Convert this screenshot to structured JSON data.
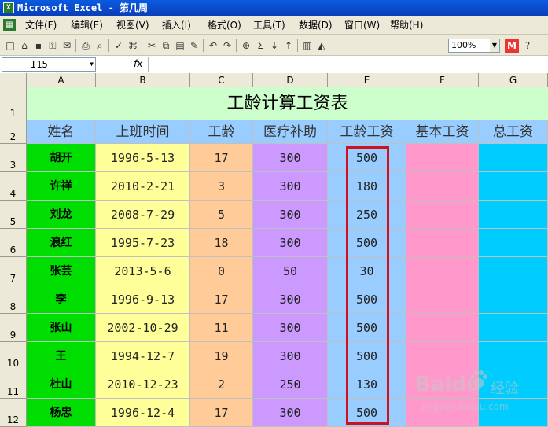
{
  "window": {
    "title": "Microsoft Excel - 第几周",
    "app_icon_name": "excel-icon"
  },
  "menu": {
    "items": [
      "文件(F)",
      "编辑(E)",
      "视图(V)",
      "插入(I)",
      "格式(O)",
      "工具(T)",
      "数据(D)",
      "窗口(W)",
      "帮助(H)"
    ]
  },
  "toolbar": {
    "zoom": "100%"
  },
  "formula_bar": {
    "name_box": "I15",
    "fx_label": "fx",
    "content": ""
  },
  "columns": [
    "A",
    "B",
    "C",
    "D",
    "E",
    "F",
    "G"
  ],
  "rows": [
    "1",
    "2",
    "3",
    "4",
    "5",
    "6",
    "7",
    "8",
    "9",
    "10",
    "11",
    "12"
  ],
  "sheet": {
    "title": "工龄计算工资表",
    "headers": [
      "姓名",
      "上班时间",
      "工龄",
      "医疗补助",
      "工龄工资",
      "基本工资",
      "总工资"
    ],
    "records": [
      {
        "name": "胡开",
        "start": "1996-5-13",
        "years": "17",
        "medical": "300",
        "seniority_pay": "500",
        "base": "",
        "total": ""
      },
      {
        "name": "许祥",
        "start": "2010-2-21",
        "years": "3",
        "medical": "300",
        "seniority_pay": "180",
        "base": "",
        "total": ""
      },
      {
        "name": "刘龙",
        "start": "2008-7-29",
        "years": "5",
        "medical": "300",
        "seniority_pay": "250",
        "base": "",
        "total": ""
      },
      {
        "name": "浪红",
        "start": "1995-7-23",
        "years": "18",
        "medical": "300",
        "seniority_pay": "500",
        "base": "",
        "total": ""
      },
      {
        "name": "张芸",
        "start": "2013-5-6",
        "years": "0",
        "medical": "50",
        "seniority_pay": "30",
        "base": "",
        "total": ""
      },
      {
        "name": "李",
        "start": "1996-9-13",
        "years": "17",
        "medical": "300",
        "seniority_pay": "500",
        "base": "",
        "total": ""
      },
      {
        "name": "张山",
        "start": "2002-10-29",
        "years": "11",
        "medical": "300",
        "seniority_pay": "500",
        "base": "",
        "total": ""
      },
      {
        "name": "王",
        "start": "1994-12-7",
        "years": "19",
        "medical": "300",
        "seniority_pay": "500",
        "base": "",
        "total": ""
      },
      {
        "name": "杜山",
        "start": "2010-12-23",
        "years": "2",
        "medical": "250",
        "seniority_pay": "130",
        "base": "",
        "total": ""
      },
      {
        "name": "杨忠",
        "start": "1996-12-4",
        "years": "17",
        "medical": "300",
        "seniority_pay": "500",
        "base": "",
        "total": ""
      }
    ]
  },
  "colors": {
    "title_bg": "#ccffcc",
    "header_bg": "#99ccff",
    "name_col": "#00dd00",
    "date_col": "#ffff99",
    "years_col": "#ffcc99",
    "medical_col": "#cc99ff",
    "seniority_col": "#99ccff",
    "base_col": "#ff99cc",
    "total_col": "#00ccff",
    "highlight_border": "#d0101c"
  },
  "watermark": {
    "logo": "Bai",
    "logo_suffix": "du",
    "sub": "经验",
    "url": "jingyan.baidu.com"
  }
}
